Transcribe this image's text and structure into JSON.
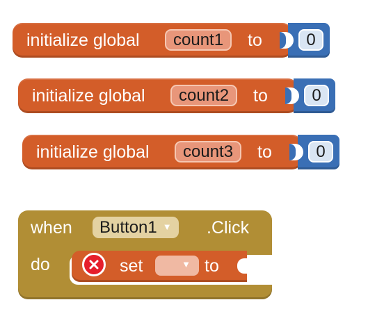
{
  "blocks": [
    {
      "keyword": "initialize global",
      "variable": "count1",
      "to_label": "to",
      "value": "0"
    },
    {
      "keyword": "initialize global",
      "variable": "count2",
      "to_label": "to",
      "value": "0"
    },
    {
      "keyword": "initialize global",
      "variable": "count3",
      "to_label": "to",
      "value": "0"
    }
  ],
  "event": {
    "when_label": "when",
    "component": "Button1",
    "event_name": ".Click",
    "do_label": "do",
    "set_label": "set",
    "set_variable": "",
    "to_label": "to"
  },
  "icons": {
    "dropdown": "dropdown-arrow-icon",
    "error": "error-icon"
  },
  "colors": {
    "variable_block": "#d35d29",
    "math_block": "#3a6fb5",
    "event_block": "#b18e35",
    "error": "#e61e2b"
  }
}
